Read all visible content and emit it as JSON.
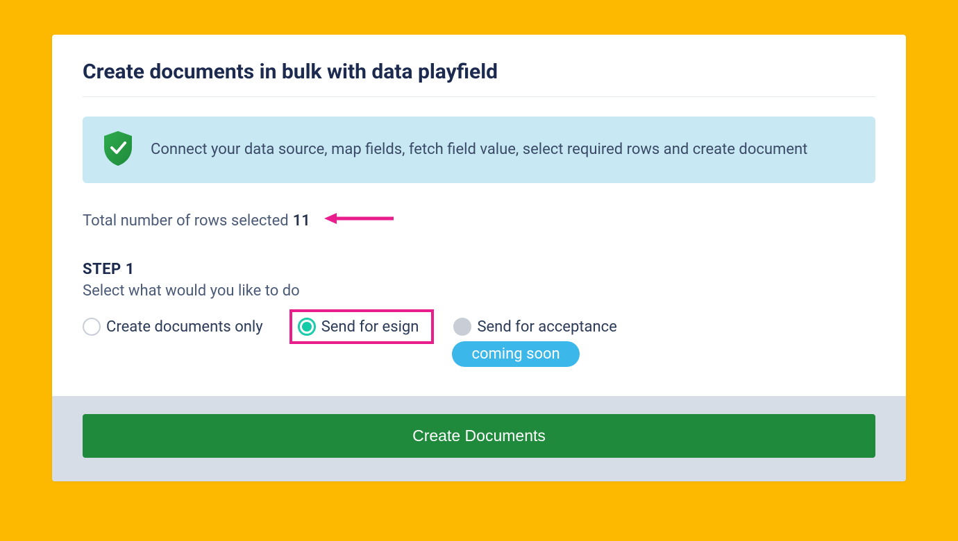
{
  "header": {
    "title": "Create documents in bulk with data playfield"
  },
  "banner": {
    "text": "Connect your data source, map fields, fetch field value, select required rows and create document"
  },
  "rows": {
    "label": "Total number of rows selected",
    "count": "11"
  },
  "step": {
    "label": "STEP 1",
    "desc": "Select what would you like to do"
  },
  "options": {
    "create_only": "Create documents only",
    "send_esign": "Send for esign",
    "send_acceptance": "Send for acceptance",
    "coming_soon": "coming soon"
  },
  "footer": {
    "create_button": "Create Documents"
  },
  "colors": {
    "accent_pink": "#e91e8c",
    "accent_green": "#14cba8",
    "brand_green": "#1f8a3b",
    "banner_bg": "#c8e9f4",
    "badge_bg": "#3bb7ea",
    "page_bg": "#fcb900"
  }
}
